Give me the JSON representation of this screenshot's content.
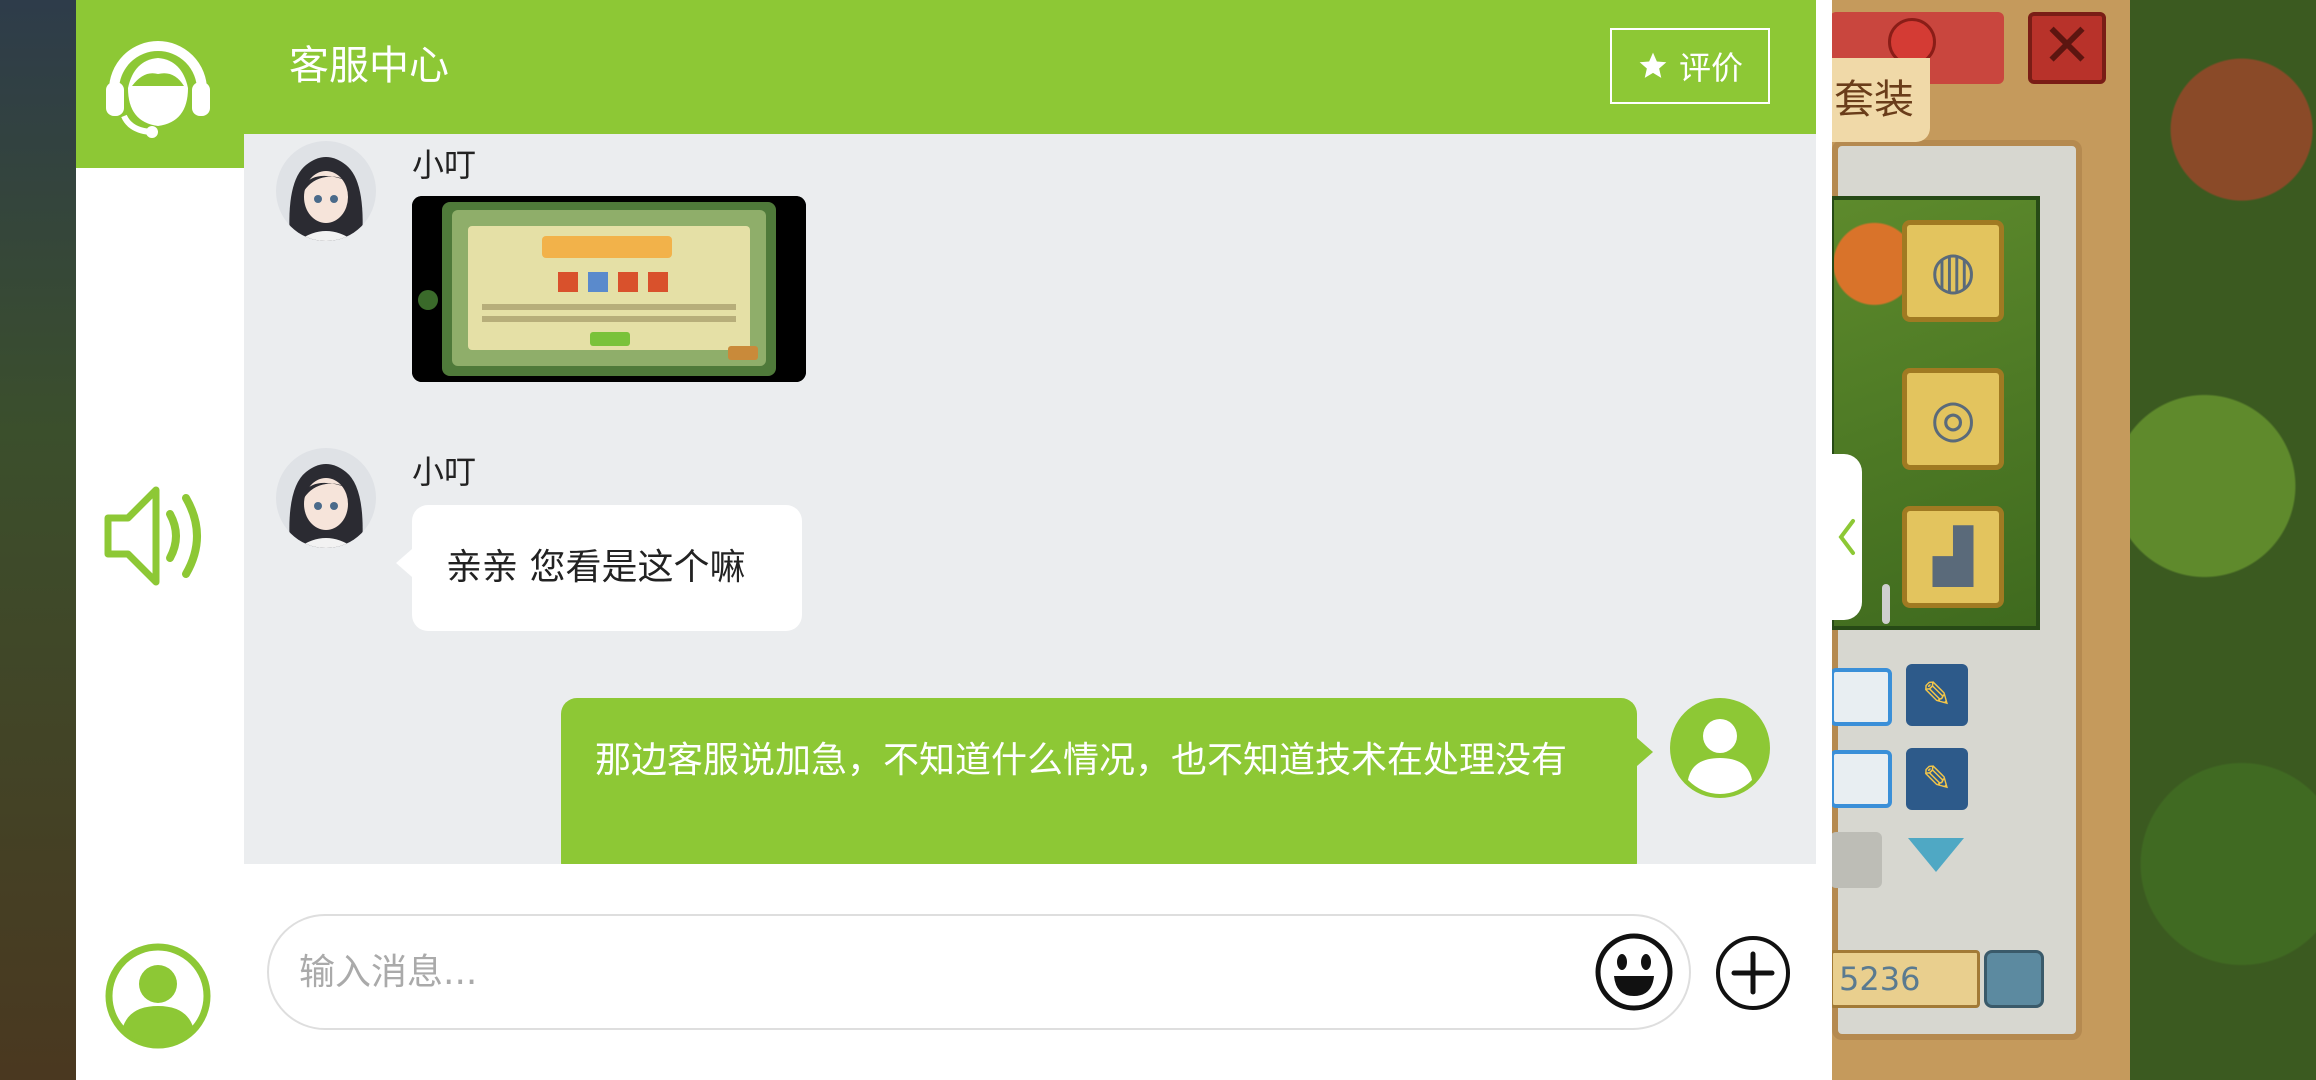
{
  "header": {
    "title": "客服中心",
    "rate_label": "评价"
  },
  "messages": [
    {
      "sender": "小叮",
      "type": "image",
      "image_desc": "game screenshot"
    },
    {
      "sender": "小叮",
      "type": "text",
      "text": "亲亲 您看是这个嘛"
    },
    {
      "sender": "user",
      "type": "text",
      "text": "那边客服说加急，不知道什么情况，也不知道技术在处理没有"
    }
  ],
  "input": {
    "placeholder": "输入消息..."
  },
  "game": {
    "tab_label": "套装",
    "number": "5236"
  },
  "colors": {
    "accent": "#8dc835",
    "chat_bg": "#ebedef",
    "bubble_left": "#ffffff"
  },
  "icons": {
    "headset": "headset-icon",
    "speaker": "speaker-icon",
    "user": "user-icon",
    "star": "star-icon",
    "emoji": "emoji-icon",
    "add": "plus-icon",
    "collapse": "chevron-left-icon"
  }
}
